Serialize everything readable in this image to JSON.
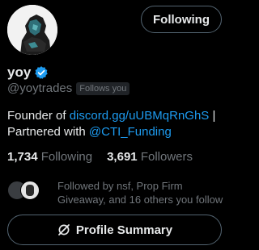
{
  "profile": {
    "display_name": "yoy",
    "handle": "@yoytrades",
    "follows_you": "Follows you",
    "verified_icon": "verified-badge-icon",
    "avatar_icon": "profile-avatar"
  },
  "actions": {
    "following_label": "Following",
    "profile_summary_label": "Profile Summary",
    "profile_summary_icon": "grok-slash-icon"
  },
  "bio": {
    "prefix": "Founder of ",
    "link": "discord.gg/uUBMqRnGhS",
    "middle": " | Partnered with ",
    "mention": "@CTI_Funding"
  },
  "stats": {
    "following_count": "1,734",
    "following_label": "Following",
    "followers_count": "3,691",
    "followers_label": "Followers"
  },
  "followed_by": {
    "text": "Followed by nsf, Prop Firm Giveaway, and 16 others you follow"
  },
  "colors": {
    "background": "#000000",
    "text": "#e7e9ea",
    "muted": "#71767b",
    "link": "#1d9bf0",
    "border": "#536471"
  }
}
